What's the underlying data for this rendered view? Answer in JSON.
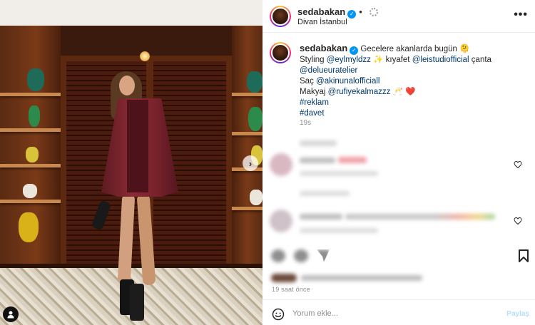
{
  "post": {
    "username": "sedabakan",
    "location": "Divan İstanbul",
    "more_icon": "more-horizontal-icon",
    "caption": {
      "line1_text": "Gecelere akanlarda bugün",
      "line1_emoji": "🫠",
      "styling_label": "Styling",
      "styling_mention": "@eylmyldzz",
      "sparkle_emoji": "✨",
      "outfit_label": "kıyafet",
      "outfit_mention": "@leistudiofficial",
      "bag_label": "çanta",
      "bag_mention": "@delueuratelier",
      "hair_label": "Saç",
      "hair_mention": "@akinunalofficiall",
      "makeup_label": "Makyaj",
      "makeup_mention": "@rufiyekalmazzz",
      "makeup_emoji": "🥂",
      "heart_emoji": "❤️",
      "hashtag1": "#reklam",
      "hashtag2": "#davet"
    },
    "caption_time": "19s",
    "post_time": "19 saat önce"
  },
  "comments": [
    {
      "username": "blurred_user_1",
      "text": "blurred comment",
      "meta": "blurred meta"
    },
    {
      "username": "blurred_user_2",
      "text": "blurred comment",
      "meta": "blurred meta"
    }
  ],
  "composer": {
    "placeholder": "Yorum ekle...",
    "post_label": "Paylaş"
  },
  "colors": {
    "link": "#00376b",
    "verified": "#0095f6",
    "muted": "#8e8e8e"
  }
}
